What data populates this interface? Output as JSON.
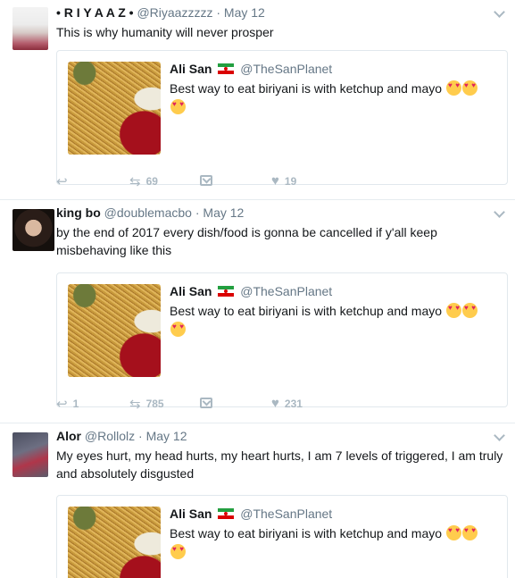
{
  "tweets": [
    {
      "name": "• R I Y A A Z •",
      "handle": "@Riyaazzzzz",
      "sep": "·",
      "time": "May 12",
      "text": "This is why humanity will never prosper",
      "quote": {
        "name": "Ali San",
        "handle": "@TheSanPlanet",
        "text": "Best way to eat biriyani is with ketchup and mayo"
      },
      "actions": {
        "replies": "",
        "retweets": "69",
        "likes": "19"
      }
    },
    {
      "name": "king bo",
      "handle": "@doublemacbo",
      "sep": "·",
      "time": "May 12",
      "text": "by the end of 2017 every dish/food is gonna be cancelled if y'all keep misbehaving like this",
      "quote": {
        "name": "Ali San",
        "handle": "@TheSanPlanet",
        "text": "Best way to eat biriyani is with ketchup and mayo"
      },
      "actions": {
        "replies": "1",
        "retweets": "785",
        "likes": "231"
      }
    },
    {
      "name": "Alor",
      "handle": "@Rollolz",
      "sep": "·",
      "time": "May 12",
      "text": "My eyes hurt, my head hurts, my heart hurts, I am 7 levels of triggered, I am truly and absolutely disgusted",
      "quote": {
        "name": "Ali San",
        "handle": "@TheSanPlanet",
        "text": "Best way to eat biriyani is with ketchup and mayo"
      }
    }
  ],
  "icons": {
    "reply": "reply-icon",
    "retweet": "retweet-icon",
    "dm": "direct-message-icon",
    "like": "heart-icon",
    "more": "chevron-down-icon"
  },
  "colors": {
    "muted": "#657786",
    "action": "#aab8c2",
    "border": "#e6ecf0"
  }
}
